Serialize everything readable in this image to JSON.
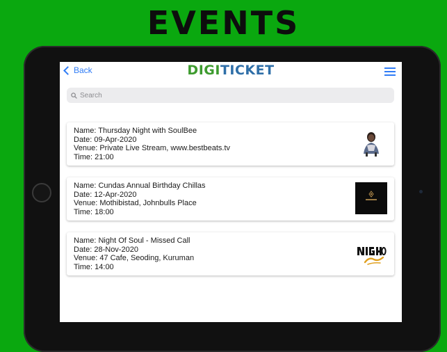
{
  "banner": {
    "title": "EVENTS"
  },
  "nav": {
    "back_label": "Back",
    "logo_part1": "DIGI",
    "logo_part2": "TICKET"
  },
  "search": {
    "placeholder": "Search",
    "value": ""
  },
  "events": [
    {
      "name": "Name: Thursday Night with SoulBee",
      "date": "Date: 09-Apr-2020",
      "venue": "Venue: Private Live Stream, www.bestbeats.tv",
      "time": "Time: 21:00",
      "image": "artist-photo"
    },
    {
      "name": "Name: Cundas Annual Birthday Chillas",
      "date": "Date: 12-Apr-2020",
      "venue": "Venue: Mothibistad, Johnbulls Place",
      "time": "Time: 18:00",
      "image": "cundas-logo"
    },
    {
      "name": "Name: Night Of Soul - Missed Call",
      "date": "Date: 28-Nov-2020",
      "venue": "Venue: 47 Cafe, Seoding, Kuruman",
      "time": "Time: 14:00",
      "image": "night-of-soul-logo"
    }
  ],
  "colors": {
    "background": "#0aa80f",
    "accent": "#2f7cf6",
    "logo_green": "#3e9b2f",
    "logo_blue": "#2f6fa8"
  }
}
